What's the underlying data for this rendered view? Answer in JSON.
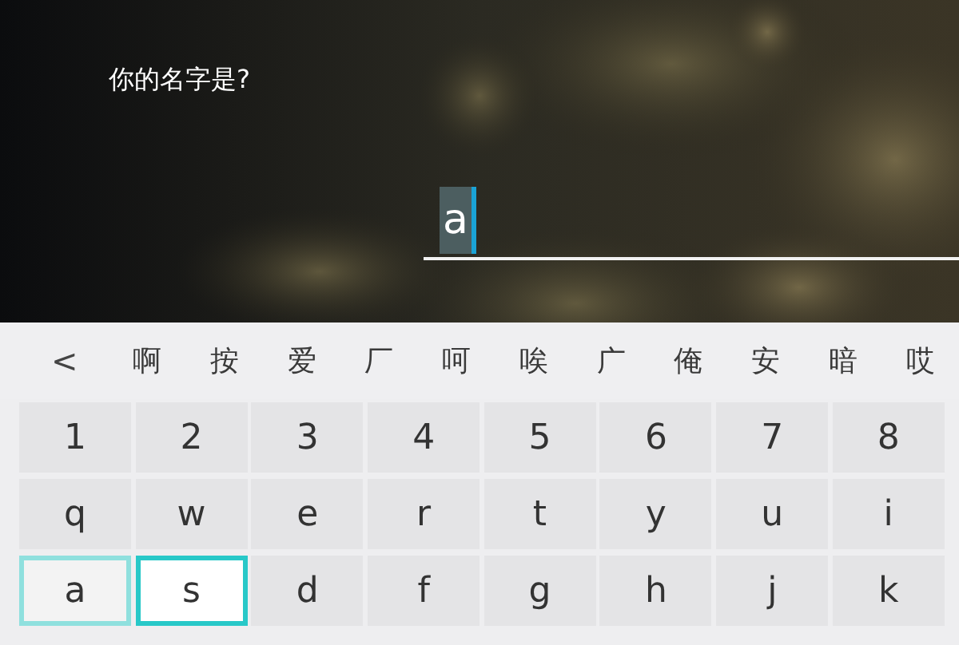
{
  "prompt": "你的名字是?",
  "input": {
    "value": "a",
    "composing": true
  },
  "candidate_bar": {
    "back": "<",
    "candidates": [
      "啊",
      "按",
      "爱",
      "厂",
      "呵",
      "唉",
      "广",
      "俺",
      "安",
      "暗",
      "哎"
    ]
  },
  "key_rows": [
    [
      {
        "label": "1",
        "selected": false,
        "fading": false
      },
      {
        "label": "2",
        "selected": false,
        "fading": false
      },
      {
        "label": "3",
        "selected": false,
        "fading": false
      },
      {
        "label": "4",
        "selected": false,
        "fading": false
      },
      {
        "label": "5",
        "selected": false,
        "fading": false
      },
      {
        "label": "6",
        "selected": false,
        "fading": false
      },
      {
        "label": "7",
        "selected": false,
        "fading": false
      },
      {
        "label": "8",
        "selected": false,
        "fading": false
      }
    ],
    [
      {
        "label": "q",
        "selected": false,
        "fading": false
      },
      {
        "label": "w",
        "selected": false,
        "fading": false
      },
      {
        "label": "e",
        "selected": false,
        "fading": false
      },
      {
        "label": "r",
        "selected": false,
        "fading": false
      },
      {
        "label": "t",
        "selected": false,
        "fading": false
      },
      {
        "label": "y",
        "selected": false,
        "fading": false
      },
      {
        "label": "u",
        "selected": false,
        "fading": false
      },
      {
        "label": "i",
        "selected": false,
        "fading": false
      }
    ],
    [
      {
        "label": "a",
        "selected": false,
        "fading": true
      },
      {
        "label": "s",
        "selected": true,
        "fading": false
      },
      {
        "label": "d",
        "selected": false,
        "fading": false
      },
      {
        "label": "f",
        "selected": false,
        "fading": false
      },
      {
        "label": "g",
        "selected": false,
        "fading": false
      },
      {
        "label": "h",
        "selected": false,
        "fading": false
      },
      {
        "label": "j",
        "selected": false,
        "fading": false
      },
      {
        "label": "k",
        "selected": false,
        "fading": false
      }
    ]
  ]
}
